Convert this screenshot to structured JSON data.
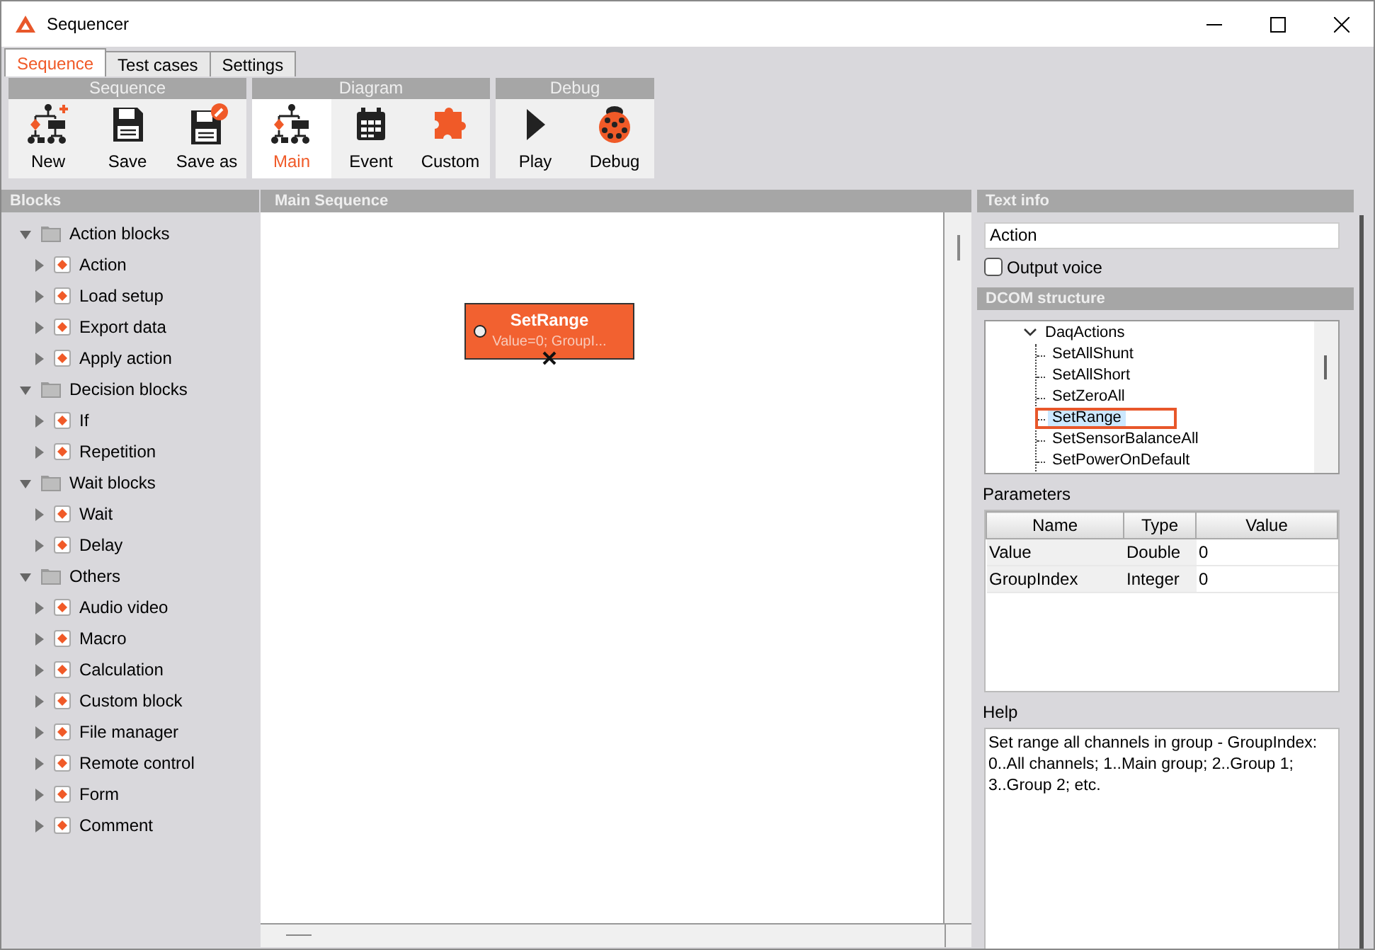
{
  "window": {
    "title": "Sequencer"
  },
  "tabs": [
    {
      "label": "Sequence",
      "selected": true
    },
    {
      "label": "Test cases",
      "selected": false
    },
    {
      "label": "Settings",
      "selected": false
    }
  ],
  "ribbon": [
    {
      "title": "Sequence",
      "buttons": [
        {
          "label": "New",
          "selected": false
        },
        {
          "label": "Save",
          "selected": false
        },
        {
          "label": "Save as",
          "selected": false
        }
      ]
    },
    {
      "title": "Diagram",
      "buttons": [
        {
          "label": "Main",
          "selected": true
        },
        {
          "label": "Event",
          "selected": false
        },
        {
          "label": "Custom",
          "selected": false
        }
      ]
    },
    {
      "title": "Debug",
      "buttons": [
        {
          "label": "Play",
          "selected": false
        },
        {
          "label": "Debug",
          "selected": false
        }
      ]
    }
  ],
  "blocks": {
    "title": "Blocks",
    "tree": [
      {
        "label": "Action blocks",
        "expanded": true,
        "children": [
          {
            "label": "Action",
            "expanded": false
          },
          {
            "label": "Load setup",
            "expanded": false
          },
          {
            "label": "Export data",
            "expanded": false
          },
          {
            "label": "Apply action",
            "expanded": false
          }
        ]
      },
      {
        "label": "Decision blocks",
        "expanded": true,
        "children": [
          {
            "label": "If",
            "expanded": false
          },
          {
            "label": "Repetition",
            "expanded": false
          }
        ]
      },
      {
        "label": "Wait blocks",
        "expanded": true,
        "children": [
          {
            "label": "Wait",
            "expanded": false
          },
          {
            "label": "Delay",
            "expanded": false
          }
        ]
      },
      {
        "label": "Others",
        "expanded": true,
        "children": [
          {
            "label": "Audio video",
            "expanded": false
          },
          {
            "label": "Macro",
            "expanded": false
          },
          {
            "label": "Calculation",
            "expanded": false
          },
          {
            "label": "Custom block",
            "expanded": false
          },
          {
            "label": "File manager",
            "expanded": false
          },
          {
            "label": "Remote control",
            "expanded": false
          },
          {
            "label": "Form",
            "expanded": false
          },
          {
            "label": "Comment",
            "expanded": false
          }
        ]
      }
    ]
  },
  "canvas": {
    "title": "Main Sequence",
    "node": {
      "title": "SetRange",
      "subtitle": "Value=0; GroupI..."
    }
  },
  "text_info": {
    "title": "Text info",
    "value": "Action",
    "output_voice": {
      "label": "Output voice",
      "checked": false
    }
  },
  "dcom": {
    "title": "DCOM structure",
    "tree": [
      {
        "label": "DaqActions",
        "expanded": true,
        "children": [
          {
            "label": "SetAllShunt",
            "selected": false
          },
          {
            "label": "SetAllShort",
            "selected": false
          },
          {
            "label": "SetZeroAll",
            "selected": false
          },
          {
            "label": "SetRange",
            "selected": true
          },
          {
            "label": "SetSensorBalanceAll",
            "selected": false
          },
          {
            "label": "SetPowerOnDefault",
            "selected": false
          }
        ]
      }
    ]
  },
  "parameters": {
    "title": "Parameters",
    "columns": [
      "Name",
      "Type",
      "Value"
    ],
    "rows": [
      [
        "Value",
        "Double",
        "0"
      ],
      [
        "GroupIndex",
        "Integer",
        "0"
      ]
    ]
  },
  "help": {
    "title": "Help",
    "text": "Set range all channels in group - GroupIndex: 0..All channels; 1..Main group; 2..Group 1; 3..Group 2; etc."
  }
}
